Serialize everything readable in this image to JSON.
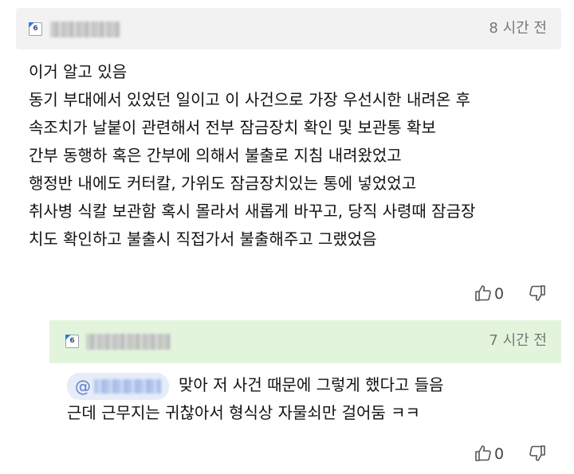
{
  "comment": {
    "level_badge": "6",
    "timestamp": "8 시간 전",
    "lines": [
      "이거 알고 있음",
      "동기 부대에서 있었던 일이고 이 사건으로 가장 우선시한 내려온 후",
      "속조치가 날붙이 관련해서 전부 잠금장치 확인 및 보관통 확보",
      "간부 동행하 혹은 간부에 의해서 불출로 지침 내려왔었고",
      "행정반 내에도 커터칼, 가위도 잠금장치있는 통에 넣었었고",
      "취사병 식칼 보관함 혹시 몰라서 새롭게 바꾸고, 당직 사령때 잠금장",
      "치도 확인하고 불출시 직접가서 불출해주고 그랬었음"
    ],
    "upvotes": "0",
    "upvote_icon": "thumbs-up-icon",
    "downvote_icon": "thumbs-down-icon"
  },
  "reply": {
    "level_badge": "6",
    "timestamp": "7 시간 전",
    "mention_symbol": "@",
    "lines": [
      "맞아 저 사건 때문에 그렇게 했다고 들음",
      "근데 근무지는 귀찮아서 형식상 자물쇠만 걸어둠 ㅋㅋ"
    ],
    "upvotes": "0"
  },
  "colors": {
    "comment_header_bg": "#f2f2f2",
    "reply_header_bg": "#e3f4dd",
    "mention_bg": "#e6ecf8",
    "timestamp": "#777777"
  }
}
